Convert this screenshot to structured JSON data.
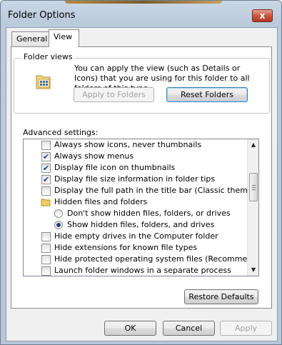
{
  "window": {
    "title": "Folder Options",
    "close_glyph": "x"
  },
  "tabs": [
    {
      "label": "General"
    },
    {
      "label": "View"
    }
  ],
  "folder_views": {
    "group_label": "Folder views",
    "description": "You can apply the view (such as Details or Icons) that you are using for this folder to all folders of this type.",
    "apply_button": "Apply to Folders",
    "reset_button": "Reset Folders",
    "icon": "folder-view-icon"
  },
  "advanced": {
    "label": "Advanced settings:",
    "items": [
      {
        "kind": "checkbox",
        "checked": false,
        "label": "Always show icons, never thumbnails"
      },
      {
        "kind": "checkbox",
        "checked": true,
        "label": "Always show menus"
      },
      {
        "kind": "checkbox",
        "checked": true,
        "label": "Display file icon on thumbnails"
      },
      {
        "kind": "checkbox",
        "checked": true,
        "label": "Display file size information in folder tips"
      },
      {
        "kind": "checkbox",
        "checked": false,
        "label": "Display the full path in the title bar (Classic theme only)"
      },
      {
        "kind": "folder",
        "label": "Hidden files and folders"
      },
      {
        "kind": "radio",
        "checked": false,
        "label": "Don't show hidden files, folders, or drives"
      },
      {
        "kind": "radio",
        "checked": true,
        "label": "Show hidden files, folders, and drives"
      },
      {
        "kind": "checkbox",
        "checked": false,
        "label": "Hide empty drives in the Computer folder"
      },
      {
        "kind": "checkbox",
        "checked": false,
        "label": "Hide extensions for known file types"
      },
      {
        "kind": "checkbox",
        "checked": false,
        "label": "Hide protected operating system files (Recommended)"
      },
      {
        "kind": "checkbox",
        "checked": false,
        "label": "Launch folder windows in a separate process"
      }
    ]
  },
  "buttons": {
    "restore_defaults": "Restore Defaults",
    "ok": "OK",
    "cancel": "Cancel",
    "apply": "Apply"
  },
  "colors": {
    "check": "#1c3e8e",
    "close": "#c9563f",
    "disabled_text": "#a0a0a0"
  }
}
